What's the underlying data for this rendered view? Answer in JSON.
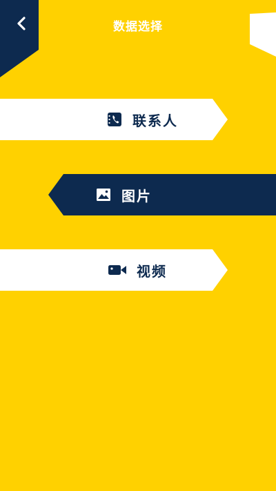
{
  "header": {
    "title": "数据选择",
    "back_icon": "chevron-left-icon"
  },
  "colors": {
    "background": "#FFD100",
    "navy": "#0D2A4F",
    "white": "#FFFFFF"
  },
  "options": [
    {
      "label": "联系人",
      "icon": "contact-phone-icon",
      "style": "light"
    },
    {
      "label": "图片",
      "icon": "image-icon",
      "style": "dark"
    },
    {
      "label": "视频",
      "icon": "video-camera-icon",
      "style": "light"
    }
  ]
}
